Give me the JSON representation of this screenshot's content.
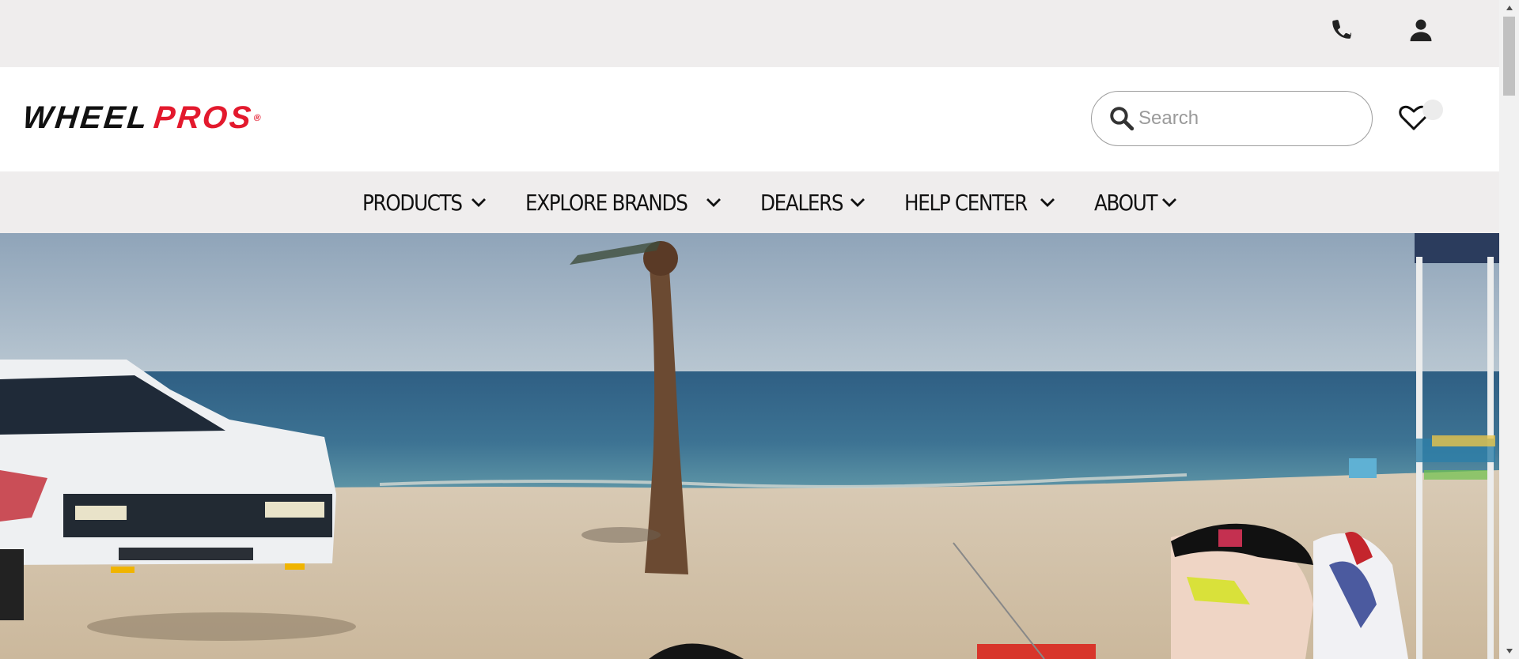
{
  "header": {
    "logo_part1": "WHEEL",
    "logo_part2": "PROS",
    "logo_mark": "®"
  },
  "search": {
    "placeholder": "Search",
    "value": ""
  },
  "icons": {
    "phone": "phone-icon",
    "account": "user-icon",
    "search": "search-icon",
    "wishlist": "heart-check-icon",
    "chevron": "chevron-down-icon"
  },
  "nav": {
    "items": [
      {
        "label": "PRODUCTS"
      },
      {
        "label": "EXPLORE BRANDS"
      },
      {
        "label": "DEALERS"
      },
      {
        "label": "HELP CENTER"
      },
      {
        "label": "ABOUT"
      }
    ]
  },
  "colors": {
    "brand_red": "#e3192d",
    "text_dark": "#111111",
    "bar_gray": "#efeded"
  }
}
